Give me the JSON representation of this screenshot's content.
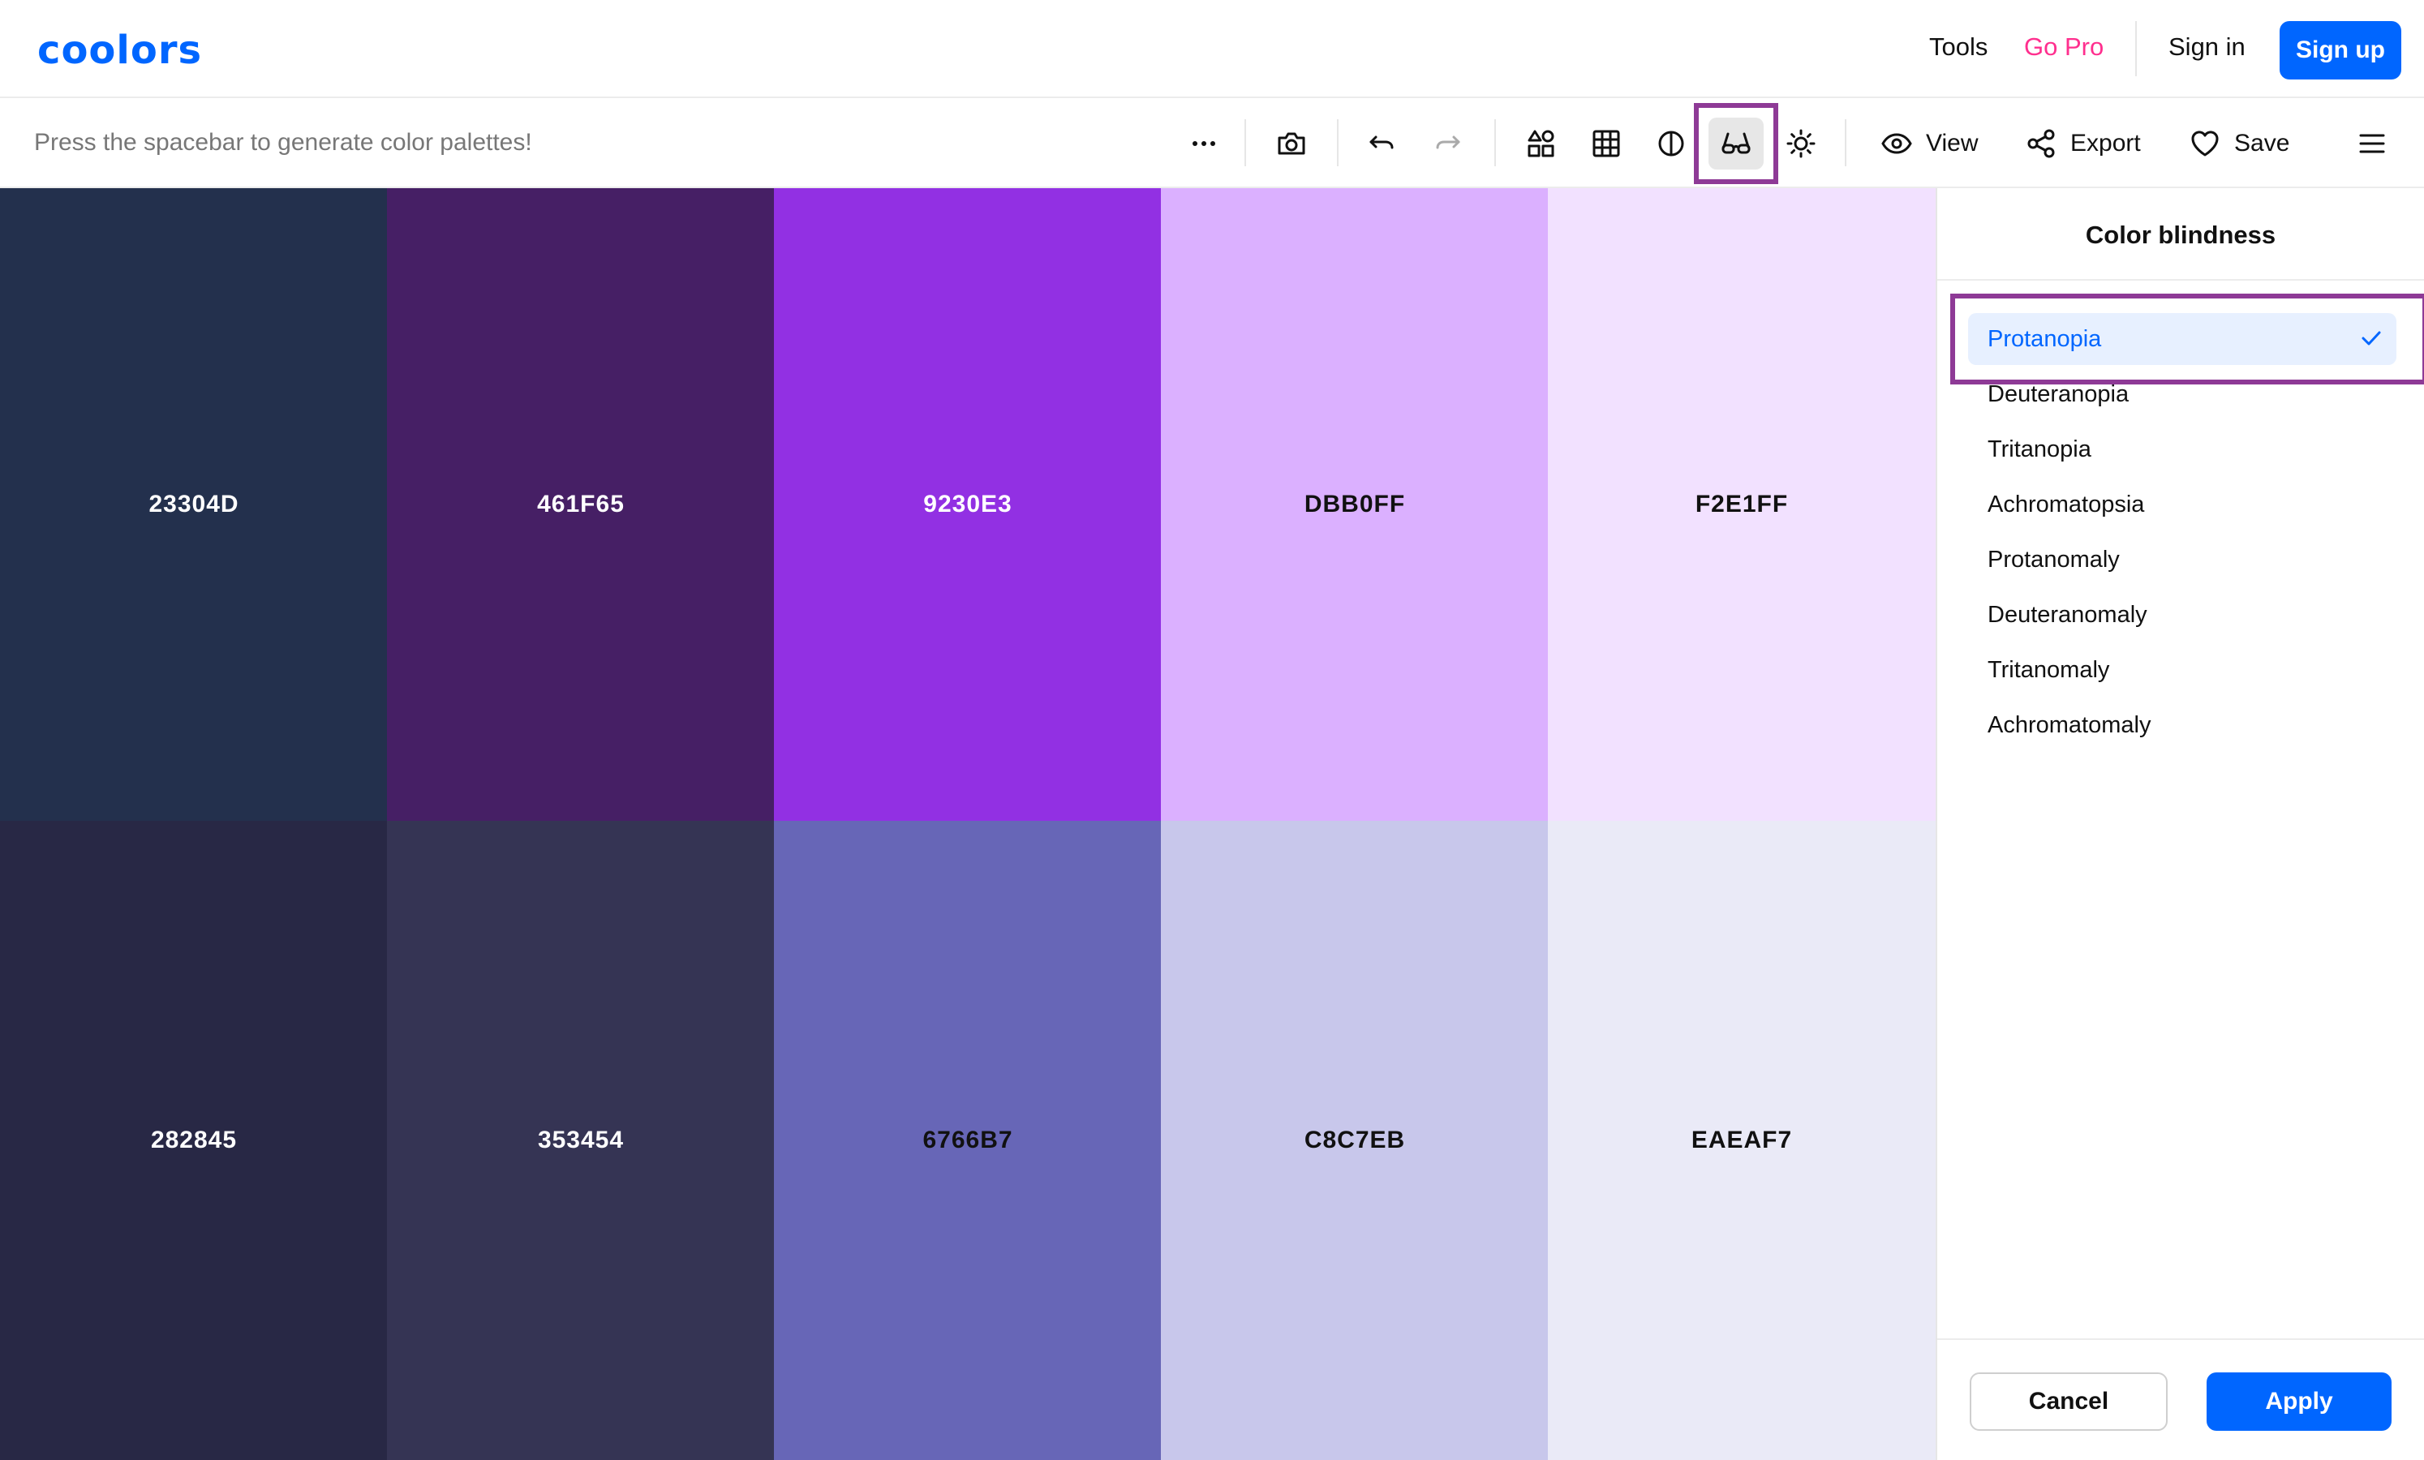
{
  "header": {
    "logo": "coolors",
    "nav": {
      "tools": "Tools",
      "go_pro": "Go Pro",
      "sign_in": "Sign in",
      "sign_up": "Sign up"
    }
  },
  "toolbar": {
    "hint": "Press the spacebar to generate color palettes!",
    "icons": [
      "more-icon",
      "camera-icon",
      "undo-icon",
      "redo-icon",
      "shapes-icon",
      "grid-icon",
      "contrast-icon",
      "glasses-icon",
      "brightness-icon"
    ],
    "actions": {
      "view": "View",
      "export": "Export",
      "save": "Save"
    }
  },
  "palettes": {
    "original": [
      {
        "hex": "23304D",
        "color": "#23304D",
        "text_color": "#ffffff"
      },
      {
        "hex": "461F65",
        "color": "#461F65",
        "text_color": "#ffffff"
      },
      {
        "hex": "9230E3",
        "color": "#9230E3",
        "text_color": "#ffffff"
      },
      {
        "hex": "DBB0FF",
        "color": "#DBB0FF",
        "text_color": "#111111"
      },
      {
        "hex": "F2E1FF",
        "color": "#F2E1FF",
        "text_color": "#111111"
      }
    ],
    "simulated": [
      {
        "hex": "282845",
        "color": "#282845",
        "text_color": "#ffffff"
      },
      {
        "hex": "353454",
        "color": "#353454",
        "text_color": "#ffffff"
      },
      {
        "hex": "6766B7",
        "color": "#6766B7",
        "text_color": "#111111"
      },
      {
        "hex": "C8C7EB",
        "color": "#C8C7EB",
        "text_color": "#111111"
      },
      {
        "hex": "EAEAF7",
        "color": "#EAEAF7",
        "text_color": "#111111"
      }
    ]
  },
  "panel": {
    "title": "Color blindness",
    "selected": "Protanopia",
    "options": [
      "Deuteranopia",
      "Tritanopia",
      "Achromatopsia",
      "Protanomaly",
      "Deuteranomaly",
      "Tritanomaly",
      "Achromatomaly"
    ],
    "cancel": "Cancel",
    "apply": "Apply"
  },
  "colors": {
    "accent": "#0066ff",
    "pro": "#ff2f8e",
    "highlight": "#8e3a96",
    "selected_bg": "#e7f0ff"
  }
}
